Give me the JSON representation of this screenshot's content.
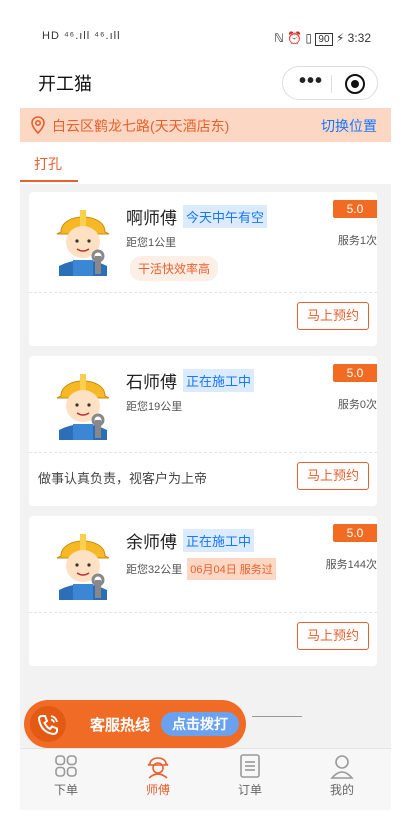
{
  "status_bar": {
    "left_indicators": "HD ⁴⁶.ıll ⁴⁶.ıll",
    "battery": "90",
    "time": "3:32"
  },
  "app": {
    "title": "开工猫"
  },
  "location": {
    "address": "白云区鹤龙七路(天天酒店东)",
    "switch_label": "切换位置"
  },
  "tabs": [
    {
      "label": "打孔",
      "active": true
    }
  ],
  "workers": [
    {
      "name": "啊师傅",
      "status": "今天中午有空",
      "distance": "距您1公里",
      "history": "",
      "rating": "5.0",
      "service_count": "服务1次",
      "tag": "干活快效率高",
      "slogan": "",
      "book_label": "马上预约"
    },
    {
      "name": "石师傅",
      "status": "正在施工中",
      "distance": "距您19公里",
      "history": "",
      "rating": "5.0",
      "service_count": "服务0次",
      "tag": "",
      "slogan": "做事认真负责，视客户为上帝",
      "book_label": "马上预约"
    },
    {
      "name": "余师傅",
      "status": "正在施工中",
      "distance": "距您32公里",
      "history": "06月04日 服务过",
      "rating": "5.0",
      "service_count": "服务144次",
      "tag": "",
      "slogan": "",
      "book_label": "马上预约"
    }
  ],
  "hotline": {
    "label": "客服热线",
    "button": "点击拨打"
  },
  "bottom_nav": [
    {
      "label": "下单",
      "icon": "grid-icon",
      "active": false
    },
    {
      "label": "师傅",
      "icon": "worker-icon",
      "active": true
    },
    {
      "label": "订单",
      "icon": "order-list-icon",
      "active": false
    },
    {
      "label": "我的",
      "icon": "profile-icon",
      "active": false
    }
  ],
  "colors": {
    "accent": "#e8602c",
    "rating_badge": "#f26b22",
    "location_bg": "#fcd7c4",
    "link_blue": "#1677ff",
    "status_chip_bg": "#dcebfb"
  }
}
